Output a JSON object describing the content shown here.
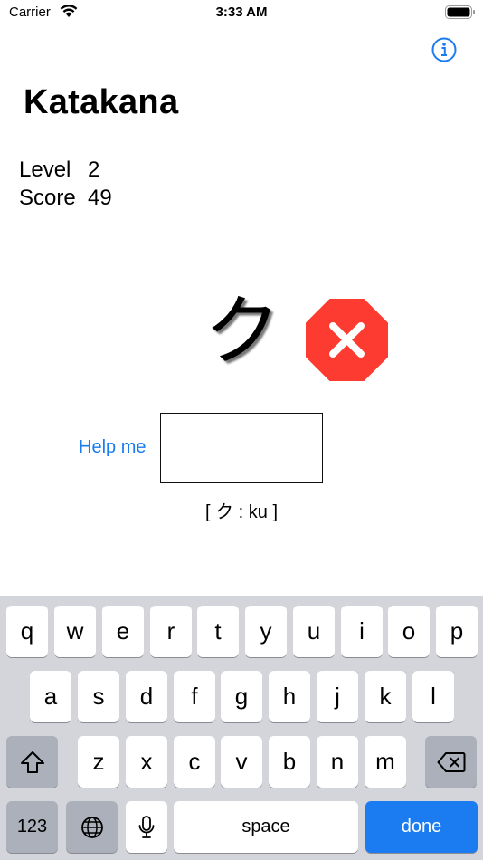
{
  "status_bar": {
    "carrier": "Carrier",
    "time": "3:33 AM"
  },
  "app": {
    "title": "Katakana"
  },
  "stats": {
    "level_label": "Level",
    "level_value": "2",
    "score_label": "Score",
    "score_value": "49"
  },
  "quiz": {
    "character": "ク",
    "result": "incorrect",
    "result_color": "#fe3b30"
  },
  "help": {
    "label": "Help me"
  },
  "answer": {
    "value": "",
    "placeholder": ""
  },
  "hint": {
    "text": "[ ク : ku ]"
  },
  "keyboard": {
    "row1": [
      "q",
      "w",
      "e",
      "r",
      "t",
      "y",
      "u",
      "i",
      "o",
      "p"
    ],
    "row2": [
      "a",
      "s",
      "d",
      "f",
      "g",
      "h",
      "j",
      "k",
      "l"
    ],
    "row3": [
      "z",
      "x",
      "c",
      "v",
      "b",
      "n",
      "m"
    ],
    "numbers_label": "123",
    "space_label": "space",
    "done_label": "done",
    "accent": "#1a7cf0"
  }
}
